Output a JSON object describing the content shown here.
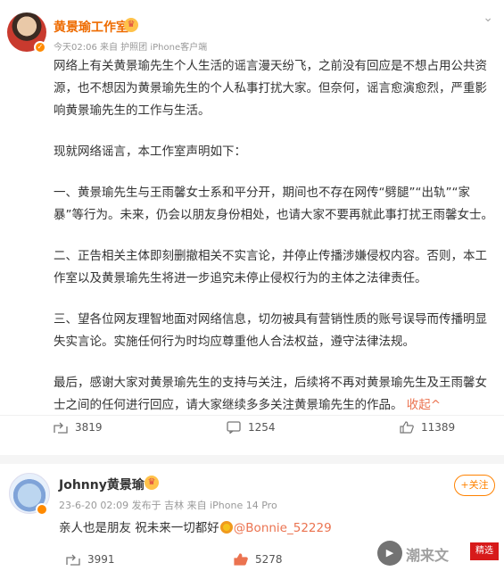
{
  "post1": {
    "author": "黄景瑜工作室",
    "meta": "今天02:06  来自 护照团 iPhone客户端",
    "paragraphs": [
      "网络上有关黄景瑜先生个人生活的谣言漫天纷飞，之前没有回应是不想占用公共资源，也不想因为黄景瑜先生的个人私事打扰大家。但奈何，谣言愈演愈烈，严重影响黄景瑜先生的工作与生活。",
      "现就网络谣言，本工作室声明如下：",
      "一、黄景瑜先生与王雨馨女士系和平分开，期间也不存在网传“劈腿”“出轨”“家暴”等行为。未来，仍会以朋友身份相处，也请大家不要再就此事打扰王雨馨女士。",
      "二、正告相关主体即刻删撤相关不实言论，并停止传播涉嫌侵权内容。否则，本工作室以及黄景瑜先生将进一步追究未停止侵权行为的主体之法律责任。",
      "三、望各位网友理智地面对网络信息，切勿被具有营销性质的账号误导而传播明显失实言论。实施任何行为时均应尊重他人合法权益，遵守法律法规。",
      "最后，感谢大家对黄景瑜先生的支持与关注，后续将不再对黄景瑜先生及王雨馨女士之间的任何进行回应，请大家继续多多关注黄景瑜先生的作品。"
    ],
    "collapse": "收起^",
    "reposts": "3819",
    "comments": "1254",
    "likes": "11389"
  },
  "post2": {
    "author": "Johnny黄景瑜",
    "meta": "23-6-20 02:09  发布于 吉林  来自 iPhone 14 Pro",
    "follow": "+关注",
    "text_before": "亲人也是朋友 祝未来一切都好",
    "mention": "@Bonnie_52229",
    "reposts": "3991",
    "likes": "5278"
  },
  "watermark": {
    "text": "潮来文",
    "stamp": "精选"
  },
  "icons": [
    "crown-icon",
    "verified-icon",
    "chevron-down-icon",
    "repost-icon",
    "comment-icon",
    "like-icon",
    "play-icon",
    "sunflower-icon"
  ],
  "colors": {
    "accent": "#eb7350",
    "name_orange": "#ee6b00",
    "follow": "#ff8200"
  }
}
